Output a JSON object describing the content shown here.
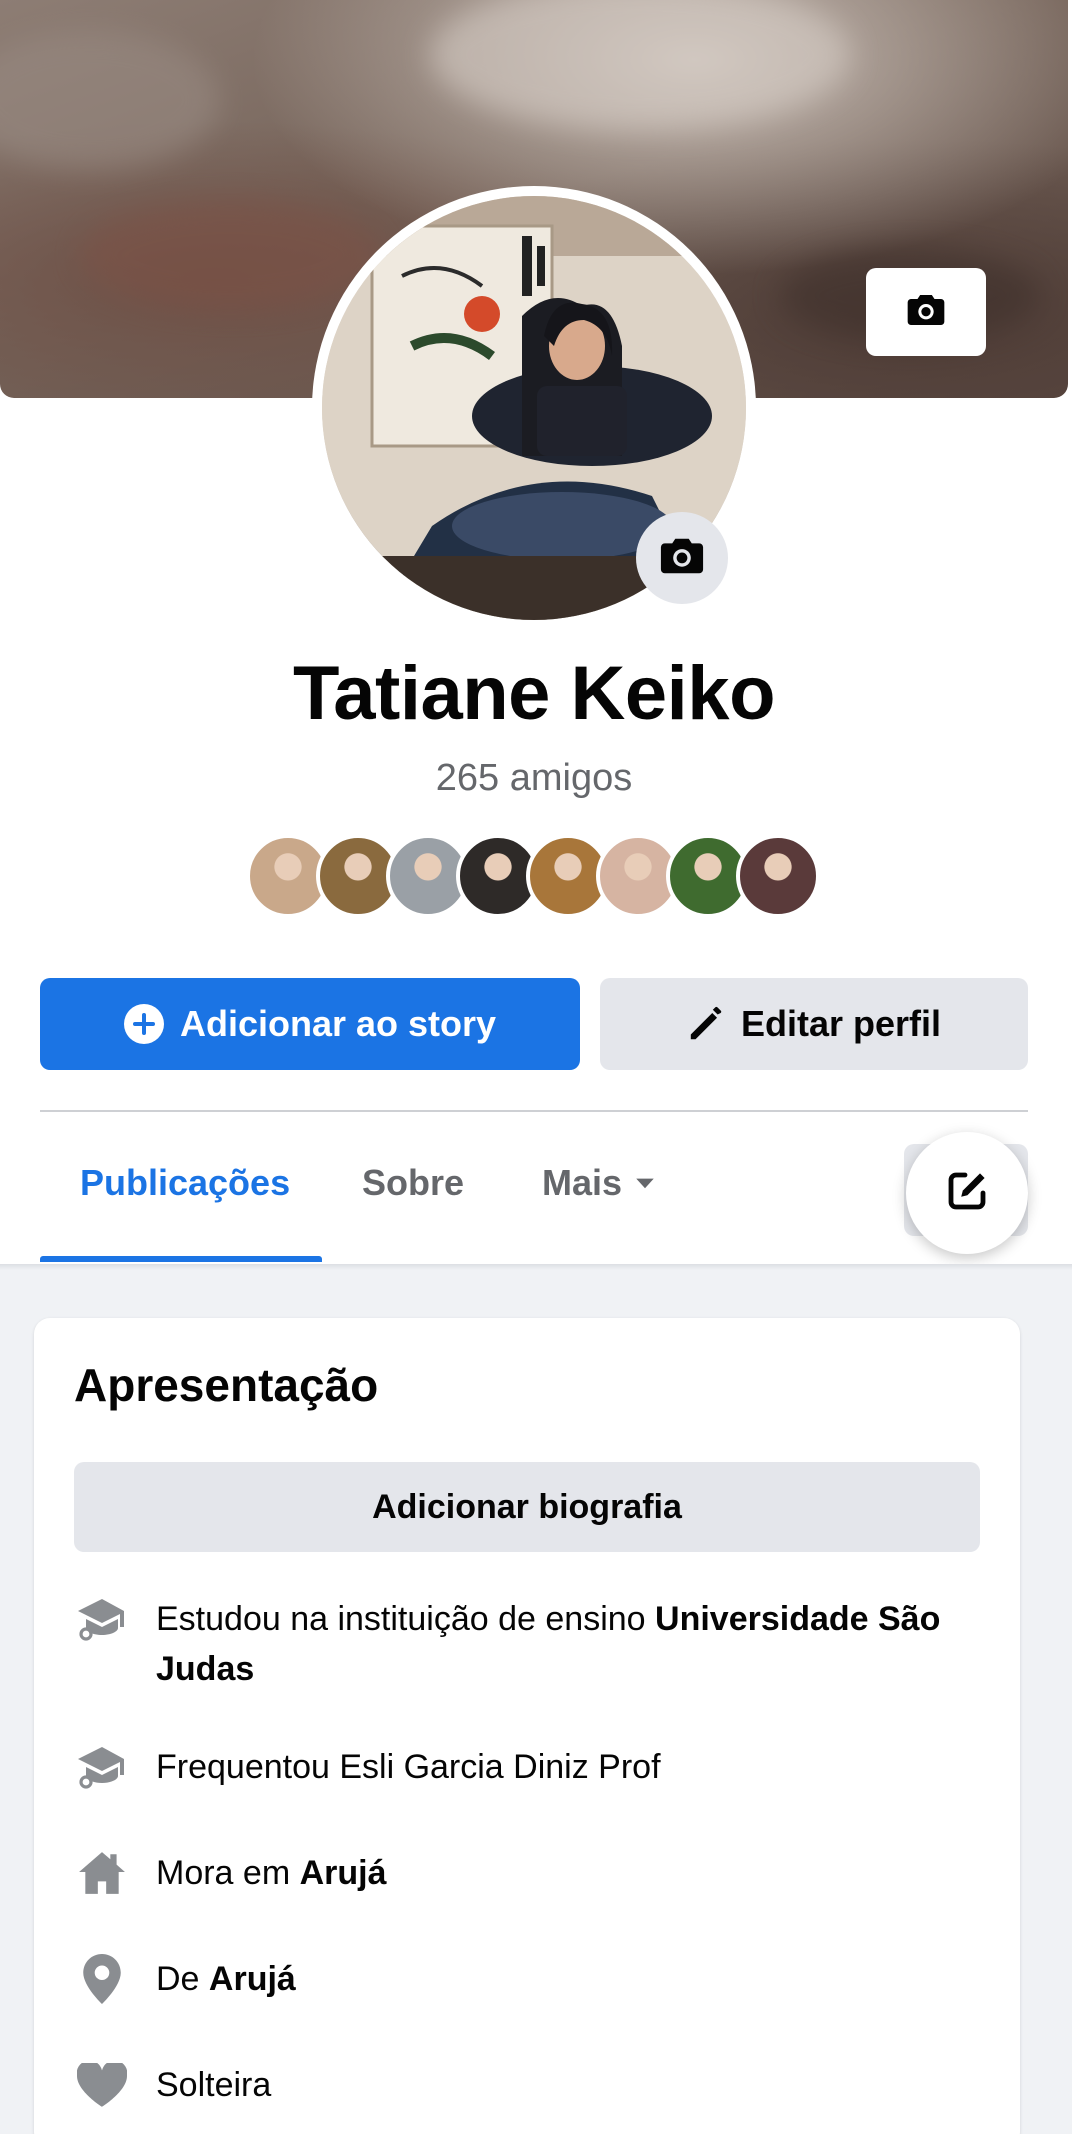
{
  "profile": {
    "name": "Tatiane Keiko",
    "friends_count": "265 amigos",
    "friend_avatar_colors": [
      "#c9a88a",
      "#8a6a3e",
      "#9aa0a6",
      "#2e2a28",
      "#a8763a",
      "#d6b4a2",
      "#3f6b2f",
      "#5a3a3a"
    ]
  },
  "actions": {
    "add_story_label": "Adicionar ao story",
    "edit_profile_label": "Editar perfil"
  },
  "tabs": {
    "posts": "Publicações",
    "about": "Sobre",
    "more": "Mais"
  },
  "intro": {
    "title": "Apresentação",
    "add_bio_label": "Adicionar biografia",
    "details": {
      "studied_prefix": "Estudou na instituição de ensino ",
      "studied_school": "Universidade São Judas",
      "attended": "Frequentou Esli Garcia Diniz Prof",
      "lives_prefix": "Mora em ",
      "lives_city": "Arujá",
      "from_prefix": "De ",
      "from_city": "Arujá",
      "relationship": "Solteira"
    }
  },
  "colors": {
    "accent": "#1b74e4",
    "secondary_text": "#65676b",
    "button_grey": "#e4e6eb",
    "feed_background": "#f0f2f5"
  },
  "icons": {
    "cover_camera": "camera-icon",
    "avatar_camera": "camera-icon",
    "story": "plus-circle-icon",
    "edit": "pencil-icon",
    "more": "caret-down-icon",
    "compose": "compose-icon",
    "education": "graduation-cap-icon",
    "home": "home-icon",
    "location": "map-pin-icon",
    "relationship": "heart-icon"
  }
}
